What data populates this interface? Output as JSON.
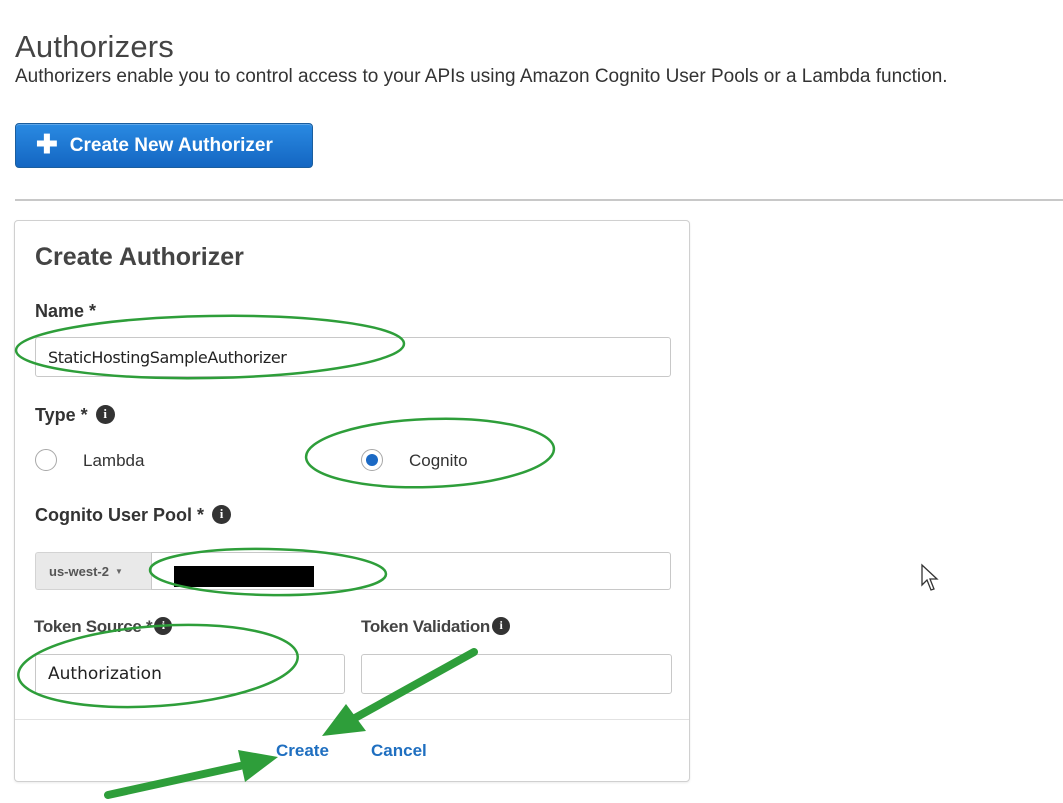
{
  "header": {
    "title": "Authorizers",
    "description": "Authorizers enable you to control access to your APIs using Amazon Cognito User Pools or a Lambda function.",
    "create_new_label": "Create New Authorizer"
  },
  "form": {
    "title": "Create Authorizer",
    "name_label": "Name *",
    "name_value": "StaticHostingSampleAuthorizer",
    "type_label": "Type *",
    "type_options": [
      {
        "label": "Lambda",
        "selected": false
      },
      {
        "label": "Cognito",
        "selected": true
      }
    ],
    "user_pool_label": "Cognito User Pool *",
    "region_value": "us-west-2",
    "token_source_label": "Token Source *",
    "token_source_value": "Authorization",
    "token_validation_label": "Token Validation",
    "token_validation_value": "",
    "create_label": "Create",
    "cancel_label": "Cancel"
  },
  "icons": {
    "info": "info-icon",
    "plus": "plus-icon",
    "dropdown": "chevron-down-icon",
    "cursor": "mouse-pointer-icon"
  },
  "colors": {
    "primary_button": "#1466c2",
    "link": "#1f6fc0",
    "radio_selected": "#1b69c4",
    "annotation": "#2e9e3a"
  }
}
